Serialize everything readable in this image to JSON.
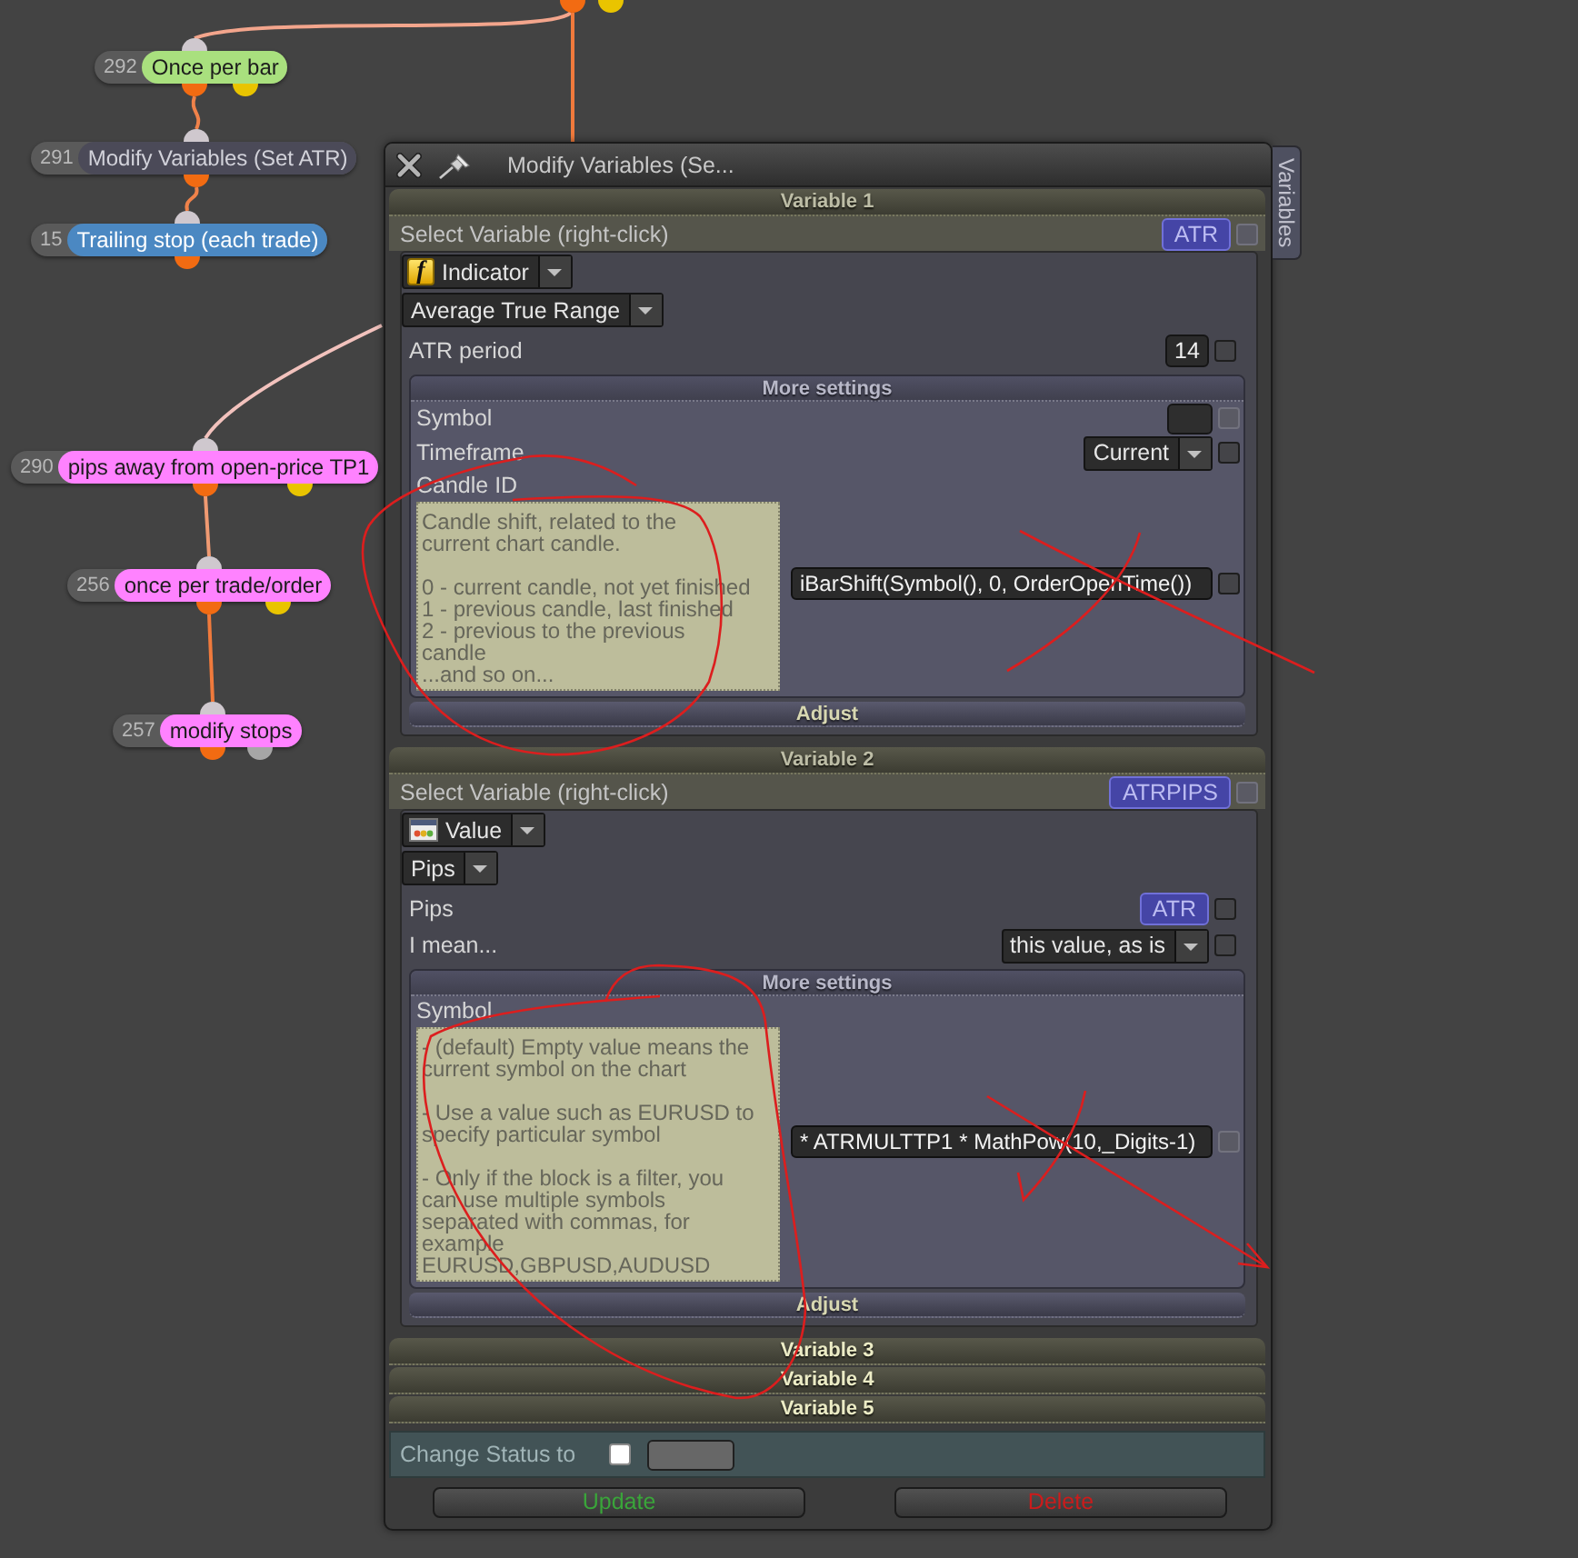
{
  "canvas": {
    "nodes": [
      {
        "kind": "offscreen",
        "outputs": [
          {
            "color": "#f26b12"
          },
          {
            "color": "#e9c400"
          }
        ]
      },
      {
        "kind": "block",
        "number": "292",
        "label": "Once per bar",
        "color": "#a9e07e",
        "outputs": [
          {
            "color": "#f26b12"
          },
          {
            "color": "#e9c400"
          }
        ]
      },
      {
        "kind": "block",
        "number": "291",
        "label": "Modify Variables (Set ATR)",
        "color": "#4b4a58",
        "outputs": [
          {
            "color": "#f26b12"
          }
        ]
      },
      {
        "kind": "block",
        "number": "15",
        "label": "Trailing stop (each trade)",
        "color": "#4b88c2",
        "outputs": [
          {
            "color": "#f26b12"
          }
        ]
      },
      {
        "kind": "block",
        "number": "290",
        "label": "pips away from open-price TP1",
        "color": "#ff82ff",
        "outputs": [
          {
            "color": "#f26b12"
          },
          {
            "color": "#e9c400"
          }
        ]
      },
      {
        "kind": "block",
        "number": "256",
        "label": "once per trade/order",
        "color": "#ff82ff",
        "outputs": [
          {
            "color": "#f26b12"
          },
          {
            "color": "#e9c400"
          }
        ]
      },
      {
        "kind": "block",
        "number": "257",
        "label": "modify stops",
        "color": "#ff82ff",
        "outputs": [
          {
            "color": "#f26b12"
          },
          {
            "color": "#a6a6a6"
          }
        ]
      }
    ]
  },
  "dialog": {
    "title": "Modify Variables (Se...",
    "side_tab": "Variables",
    "variables": [
      {
        "header": "Variable 1",
        "expanded": true,
        "select_label": "Select Variable (right-click)",
        "name": "ATR",
        "name_checkbox": {
          "checked": false,
          "disabled": true
        },
        "type": {
          "kind": "indicator",
          "glyph": "f",
          "label": "Indicator"
        },
        "source": "Average True Range",
        "params": [
          {
            "kind": "number",
            "label": "ATR period",
            "value": "14",
            "checkbox": {
              "checked": false,
              "disabled": false
            }
          }
        ],
        "more_settings": {
          "title": "More settings",
          "params": [
            {
              "kind": "text",
              "label": "Symbol",
              "checkbox": {
                "checked": false,
                "disabled": true
              }
            },
            {
              "kind": "dropdown",
              "label": "Timeframe",
              "value": "Current",
              "checkbox": {
                "checked": false,
                "disabled": false
              }
            },
            {
              "kind": "expression",
              "label": "Candle ID",
              "help": "Candle shift, related to the\ncurrent chart candle.\n\n0 - current candle, not yet finished\n1 - previous candle, last finished\n2 - previous to the previous\ncandle\n...and so on...",
              "value": "iBarShift(Symbol(), 0, OrderOpenTime())",
              "checkbox": {
                "checked": false,
                "disabled": false
              }
            }
          ]
        },
        "adjust": "Adjust"
      },
      {
        "header": "Variable 2",
        "expanded": true,
        "select_label": "Select Variable (right-click)",
        "name": "ATRPIPS",
        "name_checkbox": {
          "checked": false,
          "disabled": true
        },
        "type": {
          "kind": "value",
          "label": "Value"
        },
        "source": "Pips",
        "params": [
          {
            "kind": "variable",
            "label": "Pips",
            "value": "ATR",
            "checkbox": {
              "checked": false,
              "disabled": false
            }
          },
          {
            "kind": "dropdown",
            "label": "I mean...",
            "value": "this value, as is",
            "checkbox": {
              "checked": false,
              "disabled": false
            }
          }
        ],
        "more_settings": {
          "title": "More settings",
          "params": [
            {
              "kind": "expression",
              "label": "Symbol",
              "help": "- (default) Empty value means the\ncurrent symbol on the chart\n\n- Use a value such as EURUSD to\nspecify particular symbol\n\n- Only if the block is a filter, you\ncan use multiple symbols\nseparated with commas, for\nexample\nEURUSD,GBPUSD,AUDUSD",
              "value": "* ATRMULTTP1 * MathPow(10,_Digits-1)",
              "checkbox": {
                "checked": false,
                "disabled": true
              }
            }
          ]
        },
        "adjust": "Adjust"
      },
      {
        "header": "Variable 3",
        "expanded": false
      },
      {
        "header": "Variable 4",
        "expanded": false
      },
      {
        "header": "Variable 5",
        "expanded": false
      }
    ],
    "status_row": {
      "label": "Change Status to",
      "checked": false
    },
    "buttons": [
      {
        "kind": "update",
        "label": "Update",
        "color": "#3aa53a"
      },
      {
        "kind": "delete",
        "label": "Delete",
        "color": "#cc1b1b"
      }
    ]
  }
}
